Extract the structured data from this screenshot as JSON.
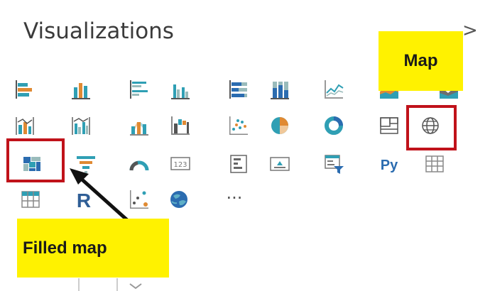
{
  "pane": {
    "title": "Visualizations",
    "collapse_glyph": ">"
  },
  "callouts": {
    "map": "Map",
    "filled_map": "Filled map"
  },
  "colors": {
    "accent_yellow": "#fff200",
    "highlight_red": "#c0121a",
    "icon_teal": "#2f9fb4",
    "icon_orange": "#e08a33",
    "icon_blue": "#2b6cb0"
  },
  "visual_icons": [
    [
      "stacked-bar-chart-icon",
      "stacked-column-chart-icon",
      "clustered-bar-chart-icon",
      "clustered-column-chart-icon",
      "100-stacked-bar-chart-icon",
      "100-stacked-column-chart-icon",
      "line-chart-icon",
      "area-chart-icon",
      "stacked-area-chart-icon"
    ],
    [
      "line-and-stacked-column-chart-icon",
      "line-and-clustered-column-chart-icon",
      "ribbon-chart-icon",
      "waterfall-chart-icon",
      "scatter-chart-icon",
      "pie-chart-icon",
      "donut-chart-icon",
      "treemap-icon",
      "map-icon"
    ],
    [
      "filled-map-icon",
      "funnel-icon",
      "gauge-icon",
      "card-icon",
      "multi-row-card-icon",
      "kpi-icon",
      "slicer-icon",
      "python-visual-icon",
      "table-icon"
    ],
    [
      "matrix-icon",
      "r-script-visual-icon",
      "key-influencers-icon",
      "arcgis-map-icon",
      "more-visuals-icon"
    ]
  ],
  "text_glyphs": {
    "card_number": "123",
    "python_label": "Py",
    "r_label": "R",
    "more_label": "···"
  }
}
